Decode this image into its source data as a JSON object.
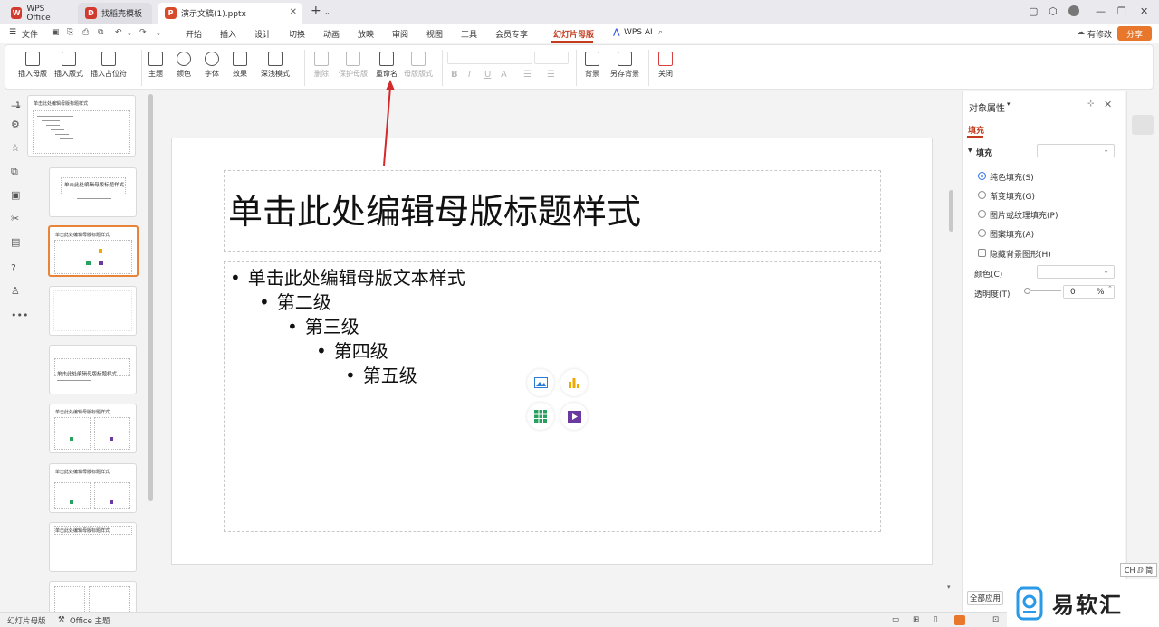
{
  "tabs": [
    {
      "label": "WPS Office",
      "color": "#d23a2f"
    },
    {
      "label": "找稻壳模板",
      "color": "#d23a2f"
    },
    {
      "label": "演示文稿(1).pptx",
      "color": "#d84b2a"
    }
  ],
  "menu": {
    "file": "文件",
    "items": [
      "开始",
      "插入",
      "设计",
      "切换",
      "动画",
      "放映",
      "审阅",
      "视图",
      "工具",
      "会员专享",
      "幻灯片母版"
    ],
    "active": "幻灯片母版",
    "wps_ai": "WPS AI",
    "edit_status": "有修改",
    "share": "分享"
  },
  "ribbon": {
    "insert_master": "插入母版",
    "insert_layout": "插入版式",
    "insert_placeholder": "插入占位符",
    "theme": "主题",
    "colors": "颜色",
    "fonts": "字体",
    "effects": "效果",
    "depth": "深浅模式",
    "delete": "删除",
    "protect_master": "保护母版",
    "rename": "重命名",
    "master_layout": "母版版式",
    "format_bold": "B",
    "format_italic": "I",
    "format_underline": "U",
    "format_color": "A",
    "background": "背景",
    "save_background": "另存背景",
    "close": "关闭"
  },
  "thumbs": {
    "index": "1",
    "master_title": "单击此处编辑母版标题样式",
    "slide2_title": "单击此处编辑母版标题样式",
    "slide5_title": "单击此处编辑母版标题样式",
    "small_title": "单击此处编辑母版标题样式"
  },
  "slide": {
    "title": "单击此处编辑母版标题样式",
    "levels": [
      "单击此处编辑母版文本样式",
      "第二级",
      "第三级",
      "第四级",
      "第五级"
    ]
  },
  "props": {
    "header": "对象属性",
    "tab": "填充",
    "section": "填充",
    "options": [
      "纯色填充(S)",
      "渐变填充(G)",
      "图片或纹理填充(P)",
      "图案填充(A)"
    ],
    "selected_option": "纯色填充(S)",
    "hide_bg": "隐藏背景图形(H)",
    "color_label": "颜色(C)",
    "transparency_label": "透明度(T)",
    "transparency_value": "0",
    "transparency_unit": "%",
    "apply_all": "全部应用"
  },
  "status": {
    "mode": "幻灯片母版",
    "theme": "Office 主题"
  },
  "ime": "CH ⅅ 简",
  "watermark": "易软汇",
  "colors": {
    "accent": "#c43c1d",
    "share": "#e8772c",
    "selected_thumb": "#e8843a",
    "arrow": "#d42a2a"
  }
}
